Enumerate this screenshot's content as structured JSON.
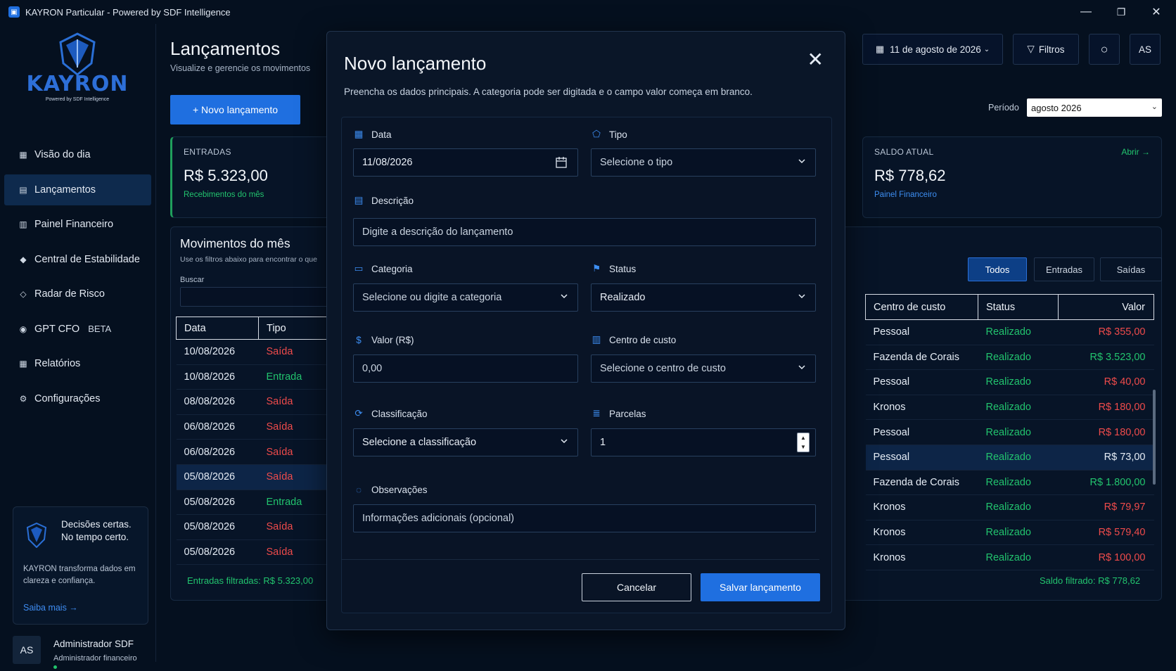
{
  "window": {
    "title": "KAYRON Particular - Powered by SDF Intelligence",
    "minimize": "—",
    "restore": "❐",
    "close": "✕"
  },
  "logo": {
    "word": "KAYRON",
    "sub": "Powered by SDF Intelligence"
  },
  "sidebar": {
    "items": [
      {
        "label": "Visão do dia",
        "icon": "grid-icon"
      },
      {
        "label": "Lançamentos",
        "icon": "list-icon",
        "active": true
      },
      {
        "label": "Painel Financeiro",
        "icon": "panel-icon"
      },
      {
        "label": "Central de Estabilidade",
        "icon": "diamond-icon"
      },
      {
        "label": "Radar de Risco",
        "icon": "diamond-outline-icon"
      },
      {
        "label": "GPT CFO",
        "icon": "gpt-icon",
        "badge": "BETA"
      },
      {
        "label": "Relatórios",
        "icon": "report-icon"
      },
      {
        "label": "Configurações",
        "icon": "gear-icon"
      }
    ],
    "promo": {
      "line1": "Decisões certas.",
      "line2": "No tempo certo.",
      "text": "KAYRON transforma dados em clareza e confiança.",
      "link": "Saiba mais →"
    },
    "user": {
      "initials": "AS",
      "name": "Administrador SDF",
      "role": "Administrador financeiro"
    }
  },
  "header": {
    "title": "Lançamentos",
    "subtitle": "Visualize e gerencie os movimentos",
    "new_button": "+ Novo lançamento",
    "date": "11 de agosto de 2026",
    "filters": "Filtros",
    "user_initials": "AS",
    "period_label": "Período",
    "period_value": "agosto 2026"
  },
  "cards": {
    "entradas": {
      "label": "ENTRADAS",
      "value": "R$ 5.323,00",
      "caption": "Recebimentos do mês"
    },
    "saldo": {
      "label": "SALDO ATUAL",
      "value": "R$ 778,62",
      "caption": "Painel Financeiro",
      "link": "Abrir →"
    }
  },
  "movements": {
    "title": "Movimentos do mês",
    "subtitle": "Use os filtros abaixo para encontrar o que",
    "search_label": "Buscar",
    "filter_tabs": [
      "Todos",
      "Entradas",
      "Saídas"
    ],
    "columns_left": [
      "Data",
      "Tipo"
    ],
    "columns_right": [
      "Centro de custo",
      "Status",
      "Valor"
    ],
    "rows": [
      {
        "date": "10/08/2026",
        "type": "Saída",
        "center": "Pessoal",
        "status": "Realizado",
        "value": "R$ 355,00",
        "kind": "out"
      },
      {
        "date": "10/08/2026",
        "type": "Entrada",
        "center": "Fazenda de Corais",
        "status": "Realizado",
        "value": "R$ 3.523,00",
        "kind": "in"
      },
      {
        "date": "08/08/2026",
        "type": "Saída",
        "center": "Pessoal",
        "status": "Realizado",
        "value": "R$ 40,00",
        "kind": "out"
      },
      {
        "date": "06/08/2026",
        "type": "Saída",
        "center": "Kronos",
        "status": "Realizado",
        "value": "R$ 180,00",
        "kind": "out"
      },
      {
        "date": "06/08/2026",
        "type": "Saída",
        "center": "Pessoal",
        "status": "Realizado",
        "value": "R$ 180,00",
        "kind": "out"
      },
      {
        "date": "05/08/2026",
        "type": "Saída",
        "center": "Pessoal",
        "status": "Realizado",
        "value": "R$ 73,00",
        "kind": "out",
        "selected": true
      },
      {
        "date": "05/08/2026",
        "type": "Entrada",
        "center": "Fazenda de Corais",
        "status": "Realizado",
        "value": "R$ 1.800,00",
        "kind": "in"
      },
      {
        "date": "05/08/2026",
        "type": "Saída",
        "center": "Kronos",
        "status": "Realizado",
        "value": "R$ 79,97",
        "kind": "out"
      },
      {
        "date": "05/08/2026",
        "type": "Saída",
        "center": "Kronos",
        "status": "Realizado",
        "value": "R$ 579,40",
        "kind": "out"
      },
      {
        "date": "",
        "type": "",
        "center": "Kronos",
        "status": "Realizado",
        "value": "R$ 100,00",
        "kind": "out"
      }
    ],
    "left_rows_visible": 9,
    "entradas_filtradas": "Entradas filtradas: R$ 5.323,00",
    "saldo_filtrado": "Saldo filtrado: R$ 778,62"
  },
  "modal": {
    "title": "Novo lançamento",
    "close": "✕",
    "description": "Preencha os dados principais. A categoria pode ser digitada e o campo valor começa em branco.",
    "fields": {
      "data": {
        "label": "Data",
        "value": "11/08/2026"
      },
      "tipo": {
        "label": "Tipo",
        "value": "Selecione o tipo"
      },
      "descricao": {
        "label": "Descrição",
        "placeholder": "Digite a descrição do lançamento"
      },
      "categoria": {
        "label": "Categoria",
        "value": "Selecione ou digite a categoria"
      },
      "status": {
        "label": "Status",
        "value": "Realizado"
      },
      "valor": {
        "label": "Valor (R$)",
        "value": "0,00"
      },
      "centro": {
        "label": "Centro de custo",
        "value": "Selecione o centro de custo"
      },
      "classificacao": {
        "label": "Classificação",
        "value": "Selecione a classificação"
      },
      "parcelas": {
        "label": "Parcelas",
        "value": "1"
      },
      "observacoes": {
        "label": "Observações",
        "placeholder": "Informações adicionais (opcional)"
      }
    },
    "cancel": "Cancelar",
    "save": "Salvar lançamento"
  },
  "colors": {
    "accent": "#1f6fe0",
    "positive": "#22c46e",
    "negative": "#ef4b4b",
    "background": "#05101f"
  }
}
